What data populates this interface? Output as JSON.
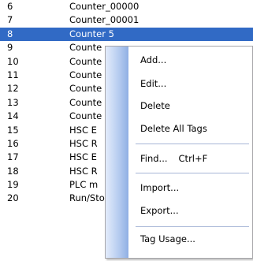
{
  "rows": [
    {
      "num": "6",
      "name": "Counter_00000"
    },
    {
      "num": "7",
      "name": "Counter_00001"
    },
    {
      "num": "8",
      "name": "Counter 5"
    },
    {
      "num": "9",
      "name": "Counte"
    },
    {
      "num": "10",
      "name": "Counte"
    },
    {
      "num": "11",
      "name": "Counte"
    },
    {
      "num": "12",
      "name": "Counte"
    },
    {
      "num": "13",
      "name": "Counte"
    },
    {
      "num": "14",
      "name": "Counte"
    },
    {
      "num": "15",
      "name": "HSC E"
    },
    {
      "num": "16",
      "name": "HSC R"
    },
    {
      "num": "17",
      "name": "HSC E"
    },
    {
      "num": "18",
      "name": "HSC R"
    },
    {
      "num": "19",
      "name": "PLC m"
    },
    {
      "num": "20",
      "name": "Run/Stop switch control (retentive)"
    }
  ],
  "context_menu": {
    "add": "Add...",
    "edit": "Edit...",
    "delete": "Delete",
    "delete_all": "Delete All Tags",
    "find": "Find...",
    "find_shortcut": "Ctrl+F",
    "import": "Import...",
    "export": "Export...",
    "tag_usage": "Tag Usage..."
  },
  "colors": {
    "selection": "#316ac5",
    "menu_gutter": "#8fafe4"
  }
}
